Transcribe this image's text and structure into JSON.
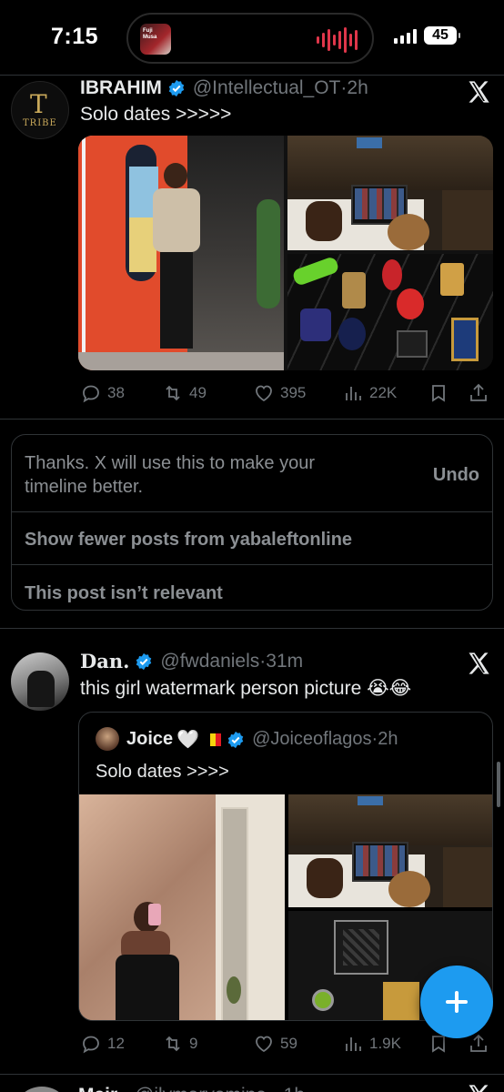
{
  "status_bar": {
    "time": "7:15",
    "battery": "45",
    "island_thumb_text": "Fuji\nMusa"
  },
  "colors": {
    "accent": "#1d9bf0",
    "background": "#000000",
    "secondary_text": "#71767b"
  },
  "tweet1": {
    "display_name": "IBRAHIM",
    "handle": "@Intellectual_OT",
    "dot": "·",
    "age": "2h",
    "text": "Solo dates >>>>>",
    "avatar_logo": "T",
    "avatar_word": "TRIBE",
    "icons": [
      "verified-badge-icon",
      "x-logo-icon"
    ],
    "stats": {
      "replies": "38",
      "reposts": "49",
      "likes": "395",
      "views": "22K"
    }
  },
  "feedback": {
    "message": "Thanks. X will use this to make your timeline better.",
    "undo": "Undo",
    "option_1": "Show fewer posts from yabaleftonline",
    "option_2": "This post isn’t relevant"
  },
  "tweet2": {
    "display_name": "Dan.",
    "handle": "@fwdaniels",
    "dot": "·",
    "age": "31m",
    "text": "this girl watermark person picture 😭😂",
    "quote": {
      "display_name": "Joice",
      "heart": "🤍",
      "handle": "@Joiceoflagos",
      "dot": "·",
      "age": "2h",
      "text": "Solo dates >>>>"
    },
    "stats": {
      "replies": "12",
      "reposts": "9",
      "likes": "59",
      "views": "1.9K"
    }
  },
  "next_tweet": {
    "display_name": "Mair",
    "handle": "@ilymaryamina · 1h"
  },
  "fab_icon": "compose-plus-icon"
}
